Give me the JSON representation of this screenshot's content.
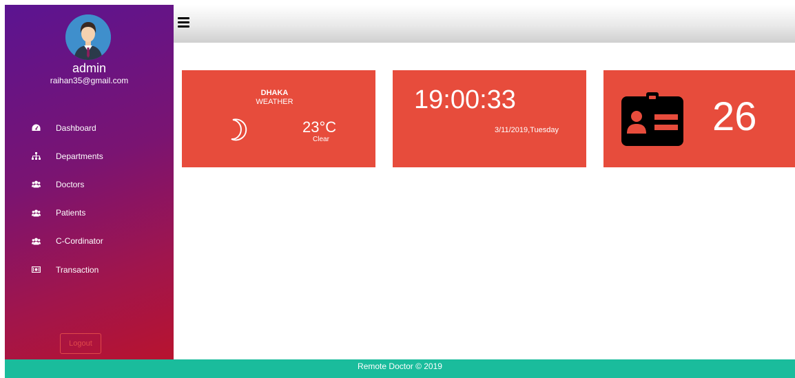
{
  "sidebar": {
    "user": {
      "name": "admin",
      "email": "raihan35@gmail.com"
    },
    "items": [
      {
        "label": "Dashboard",
        "icon": "dashboard-icon"
      },
      {
        "label": "Departments",
        "icon": "sitemap-icon"
      },
      {
        "label": "Doctors",
        "icon": "users-icon"
      },
      {
        "label": "Patients",
        "icon": "users-icon"
      },
      {
        "label": "C-Cordinator",
        "icon": "users-icon"
      },
      {
        "label": "Transaction",
        "icon": "money-icon"
      }
    ],
    "logout_label": "Logout"
  },
  "topbar": {
    "menu_icon": "hamburger-icon"
  },
  "cards": {
    "weather": {
      "city": "DHAKA",
      "label": "WEATHER",
      "temperature": "23°C",
      "condition": "Clear",
      "icon": "moon-icon"
    },
    "clock": {
      "time": "19:00:33",
      "date": "3/11/2019,Tuesday"
    },
    "count": {
      "value": "26",
      "icon": "id-card-icon"
    }
  },
  "footer": {
    "text": "Remote Doctor © 2019"
  },
  "colors": {
    "card": "#e74c3c",
    "footer": "#1abc9c",
    "sidebar_top": "#5b1491",
    "sidebar_bottom": "#b8142f"
  }
}
